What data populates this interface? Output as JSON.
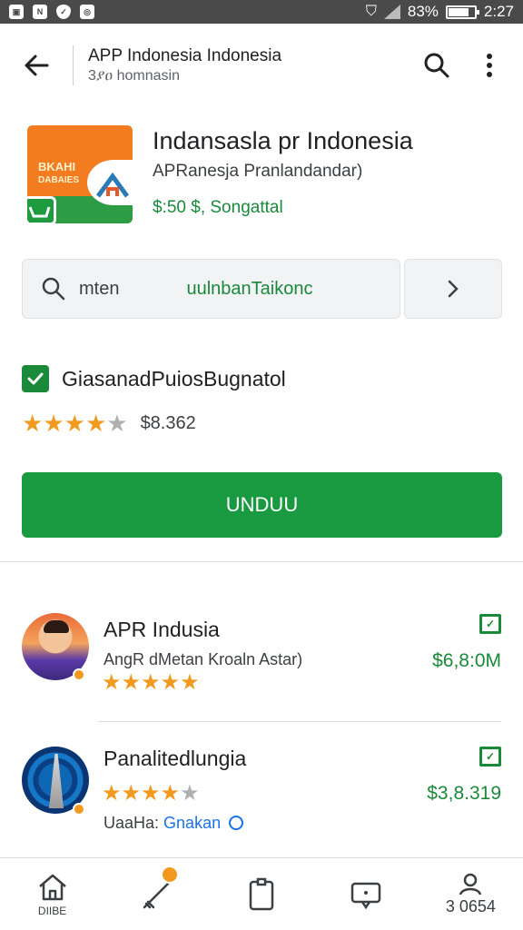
{
  "status_bar": {
    "battery": "83%",
    "time": "2:27"
  },
  "app_bar": {
    "title": "APP Indonesia Indonesia",
    "subtitle": "3ያዐ homnasin",
    "back_icon": "arrow-left-icon",
    "search_icon": "search-icon",
    "menu_icon": "more-vert-icon"
  },
  "app": {
    "name": "Indansasla pr Indonesia",
    "developer": "APRanesja Pranlandandar)",
    "price": "$:50 $, Songattal",
    "icon_text_line1": "BKAHI",
    "icon_text_line2": "DABAIES"
  },
  "search": {
    "text": "mten",
    "highlight": "uulnbanTaikonc"
  },
  "checkbox": {
    "label": "GiasanadPuiosBugnatol",
    "checked": true
  },
  "rating": {
    "stars": 4,
    "max": 5,
    "count": "$8.362"
  },
  "install_label": "UNDUU",
  "list": [
    {
      "title": "APR Indusia",
      "subtitle": "AngR dMetan Kroaln Astar)",
      "stars": 5,
      "price": "$6,8:0M"
    },
    {
      "title": "Panalitedlungia",
      "stars": 4,
      "price": "$3,8.319",
      "sub_prefix": "UaaHa:",
      "sub_link": "Gnakan"
    }
  ],
  "bottom_nav": [
    {
      "icon": "home-icon",
      "label": "DIIBE"
    },
    {
      "icon": "rocket-icon",
      "label": ""
    },
    {
      "icon": "clipboard-icon",
      "label": ""
    },
    {
      "icon": "chat-icon",
      "label": ""
    },
    {
      "icon": "person-icon",
      "label": "3 0654"
    }
  ],
  "colors": {
    "accent": "#1a9a40",
    "star": "#f29a1f",
    "link": "#1a73e8"
  }
}
